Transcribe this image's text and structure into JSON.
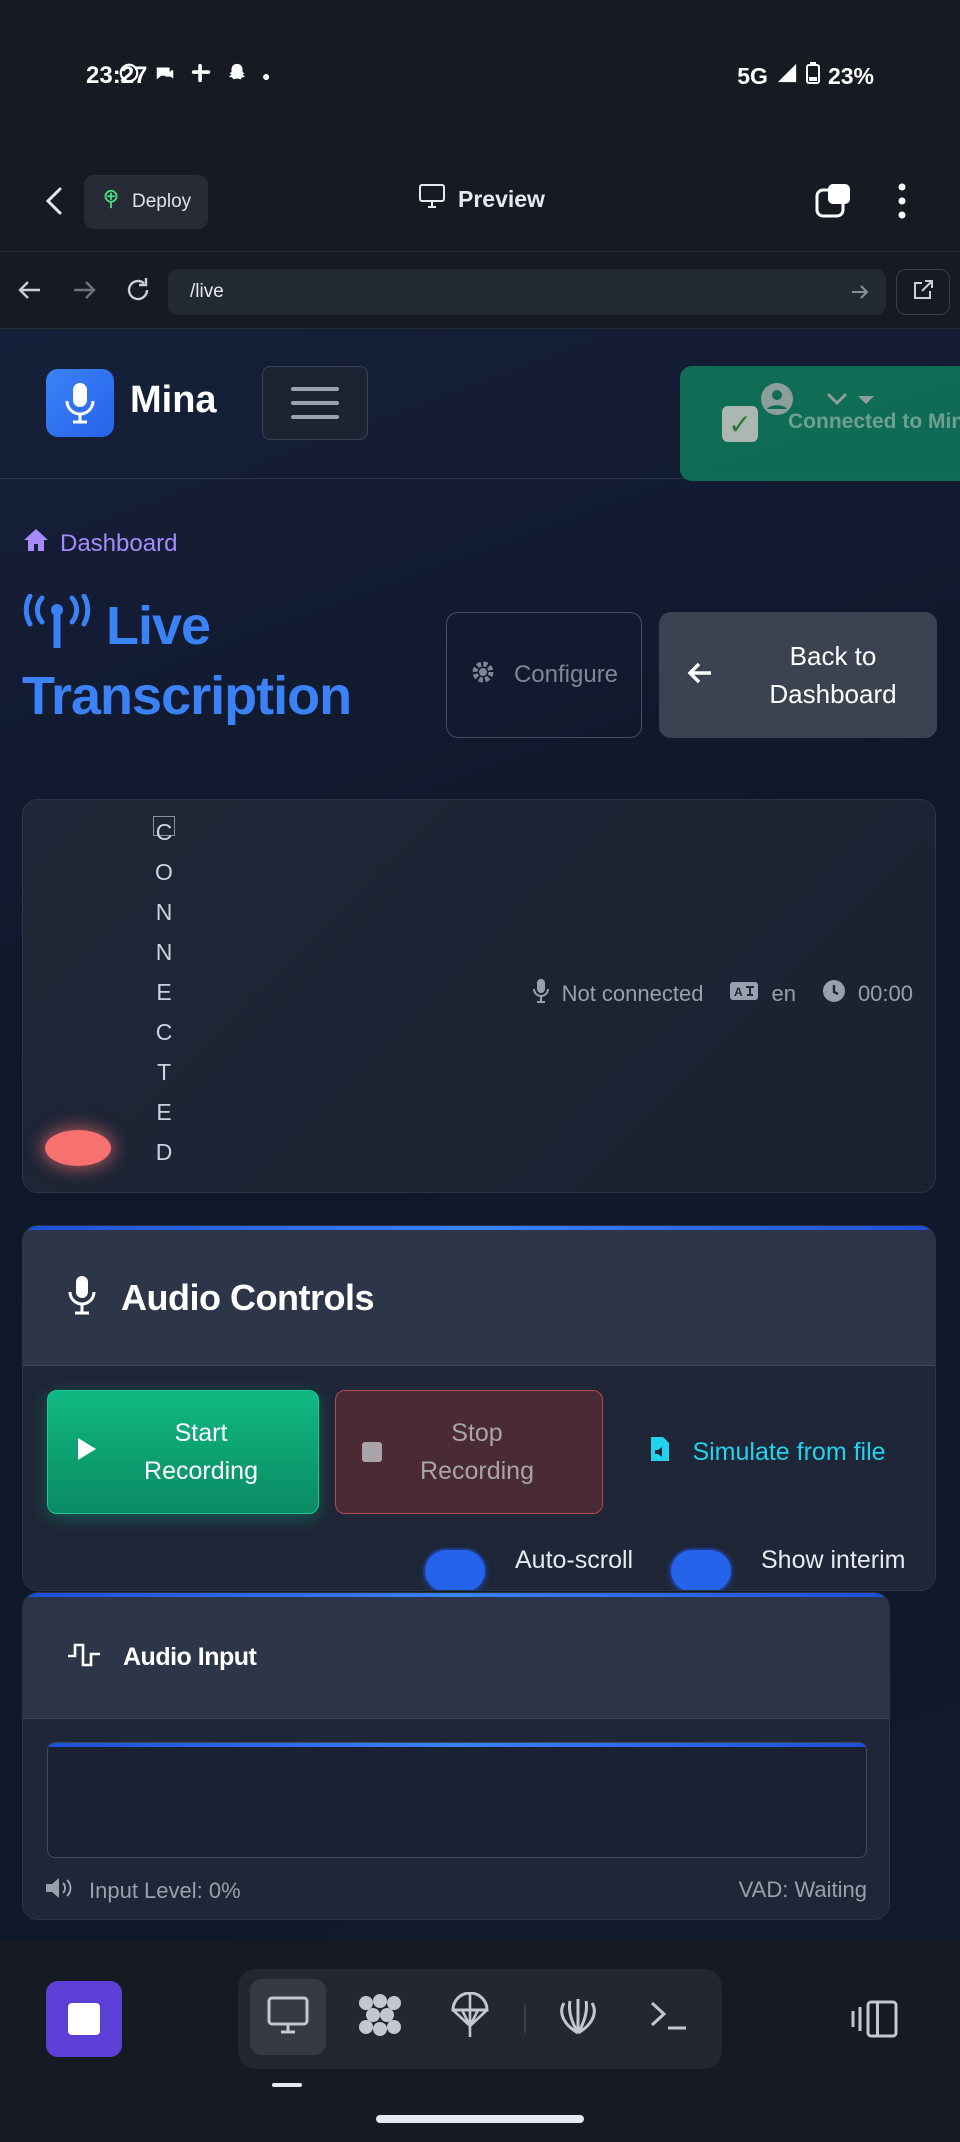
{
  "statusbar": {
    "time": "23:27",
    "network": "5G",
    "battery": "23%"
  },
  "app_header": {
    "deploy_label": "Deploy",
    "preview_label": "Preview"
  },
  "urlbar": {
    "url": "/live"
  },
  "site": {
    "brand": "Mina",
    "toast": "Connected to Mina",
    "breadcrumb": "Dashboard",
    "title": "Live Transcription",
    "configure_label": "Configure",
    "back_label": "Back to Dashboard"
  },
  "status_card": {
    "vertical_status": [
      "C",
      "O",
      "N",
      "N",
      "E",
      "C",
      "T",
      "E",
      "D"
    ],
    "mic_status": "Not connected",
    "language": "en",
    "timer": "00:00"
  },
  "audio_controls": {
    "title": "Audio Controls",
    "start_label": "Start Recording",
    "stop_label": "Stop Recording",
    "simulate_label": "Simulate from file",
    "autoscroll_label": "Auto-scroll",
    "interim_label": "Show interim"
  },
  "audio_input": {
    "title": "Audio Input",
    "input_level": "Input Level: 0%",
    "vad": "VAD: Waiting"
  },
  "colors": {
    "accent": "#3b82f6",
    "success": "#10b981",
    "danger": "#f87171",
    "brand_purple": "#5b3fd6"
  }
}
